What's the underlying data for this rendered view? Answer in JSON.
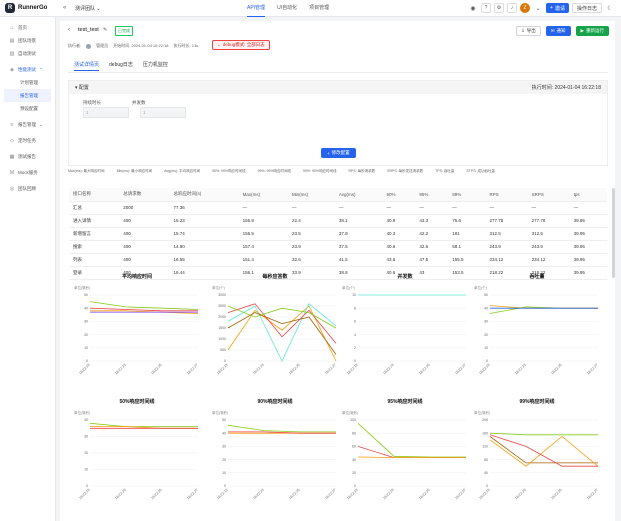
{
  "topbar": {
    "logo_text": "RunnerGo",
    "project": "测评团队",
    "nav": [
      "API管理",
      "UI自动化",
      "项目管理"
    ],
    "active_nav": 0,
    "invite_label": "邀请",
    "log_label": "操作日志",
    "avatar_letter": "Z"
  },
  "sidebar": {
    "items": [
      {
        "icon": "⌂",
        "label": "首页"
      },
      {
        "icon": "▤",
        "label": "团队场景"
      },
      {
        "icon": "▥",
        "label": "自动测试"
      },
      {
        "icon": "◈",
        "label": "性能测试"
      },
      {
        "icon": "≡",
        "label": "报告管理"
      },
      {
        "icon": "◇",
        "label": "定时任务"
      },
      {
        "icon": "▦",
        "label": "测试报告"
      },
      {
        "icon": "M",
        "label": "Mock服务"
      },
      {
        "icon": "◎",
        "label": "团队回顾"
      }
    ],
    "sub_items": [
      "计划管理",
      "报告管理",
      "预设配置"
    ],
    "active_sub": 1
  },
  "header": {
    "test_name": "test_test",
    "status_tag": "已完成",
    "executor_label": "执行者:",
    "executor": "管理员",
    "start_time": "开始时间: 2024-01-04 16:22:18",
    "duration": "执行时长: 13s",
    "debug_label": "debug模式: 全部日志",
    "actions": [
      "导出",
      "通知",
      "重新运行"
    ]
  },
  "tabs": [
    "测试详情页",
    "debug日志",
    "压力机监控"
  ],
  "active_tab": 0,
  "config": {
    "title": "配置",
    "exec_time": "执行时间: 2024-01-04 16:22:18",
    "labels": [
      "持续时长",
      "并发数"
    ],
    "inputs": [
      "1",
      "1"
    ],
    "add_label": "修改配置"
  },
  "legend": [
    "Max(ms): 最大响应时间",
    "Min(ms): 最小响应时间",
    "Avg(ms): 平均响应时间",
    "90%: 90%响应时间线",
    "95%: 95%响应时间线",
    "99%: 99%响应时间线",
    "RPS: 每秒请求数",
    "SRPS: 每秒发送请求数",
    "TPS: 吞吐量",
    "STPS: 成功吞吐量"
  ],
  "table": {
    "columns": [
      "接口名称",
      "总请求数",
      "总响应时间(s)",
      "Max(ms)",
      "Min(ms)",
      "Avg(ms)",
      "90%",
      "95%",
      "99%",
      "RPS",
      "SRPS",
      "tps"
    ],
    "rows": [
      [
        "汇总",
        "2000",
        "77.36",
        "—",
        "—",
        "—",
        "—",
        "—",
        "—",
        "—",
        "—",
        "—"
      ],
      [
        "进入详情",
        "400",
        "15.23",
        "156.9",
        "22.4",
        "38.1",
        "40.9",
        "43.3",
        "75.6",
        "277.78",
        "277.78",
        "39.95"
      ],
      [
        "新增留言",
        "400",
        "15.74",
        "156.5",
        "23.5",
        "37.9",
        "40.3",
        "42.2",
        "181",
        "312.5",
        "312.5",
        "39.95"
      ],
      [
        "搜索",
        "400",
        "14.90",
        "157.4",
        "23.9",
        "37.5",
        "40.6",
        "42.6",
        "58.1",
        "243.9",
        "243.9",
        "39.95"
      ],
      [
        "列表",
        "400",
        "16.55",
        "151.4",
        "32.6",
        "41.5",
        "43.6",
        "47.5",
        "155.5",
        "234.12",
        "234.12",
        "39.95"
      ],
      [
        "登录",
        "400",
        "16.44",
        "156.1",
        "33.9",
        "38.8",
        "40.6",
        "43",
        "153.5",
        "218.22",
        "218.22",
        "39.95"
      ]
    ]
  },
  "chart_data": [
    {
      "type": "line",
      "title": "平均响应时间",
      "ylabel": "单位(毫秒)",
      "ylim": [
        0,
        50
      ],
      "yticks": [
        0,
        10,
        20,
        30,
        40,
        50
      ],
      "x": [
        "16:22:19",
        "16:22:23",
        "16:22:25",
        "16:22:27"
      ],
      "series": [
        {
          "color": "#84cc16",
          "values": [
            45,
            41,
            40,
            39
          ]
        },
        {
          "color": "#f59e0b",
          "values": [
            38,
            38,
            37,
            36
          ]
        },
        {
          "color": "#ef4444",
          "values": [
            40,
            39,
            38,
            38
          ]
        },
        {
          "color": "#8b5cf6",
          "values": [
            37,
            37,
            37,
            37
          ]
        }
      ]
    },
    {
      "type": "line",
      "title": "每秒应答数",
      "ylabel": "单位(个)",
      "ylim": [
        0,
        3000
      ],
      "yticks": [
        0,
        500,
        1000,
        1500,
        2000,
        2500,
        3000
      ],
      "x": [
        "16:22:19",
        "16:22:23",
        "16:22:25",
        "16:22:27"
      ],
      "series": [
        {
          "color": "#f59e0b",
          "values": [
            500,
            2300,
            1400,
            2500,
            0
          ]
        },
        {
          "color": "#5eead4",
          "values": [
            1800,
            2500,
            0,
            2600,
            1600
          ]
        },
        {
          "color": "#ef4444",
          "values": [
            2200,
            2600,
            1100,
            2300,
            800
          ]
        },
        {
          "color": "#84cc16",
          "values": [
            2500,
            2000,
            2400,
            2200,
            1500
          ]
        },
        {
          "color": "#a16207",
          "values": [
            1500,
            2200,
            1700,
            2000,
            300
          ]
        }
      ]
    },
    {
      "type": "line",
      "title": "并发数",
      "ylabel": "单位(个)",
      "ylim": [
        0,
        10
      ],
      "yticks": [
        0,
        2,
        4,
        6,
        8,
        10
      ],
      "x": [
        "16:22:19",
        "16:22:23",
        "16:22:25",
        "16:22:27"
      ],
      "series": [
        {
          "color": "#5eead4",
          "values": [
            10,
            10,
            10,
            10
          ]
        }
      ]
    },
    {
      "type": "line",
      "title": "吞吐量",
      "ylabel": "单位(个)",
      "ylim": [
        0,
        50
      ],
      "yticks": [
        0,
        10,
        20,
        30,
        40,
        50
      ],
      "x": [
        "16:22:19",
        "16:22:23",
        "16:22:25",
        "16:22:27"
      ],
      "series": [
        {
          "color": "#84cc16",
          "values": [
            36,
            41,
            40,
            40
          ]
        },
        {
          "color": "#f59e0b",
          "values": [
            42,
            40,
            40,
            40
          ]
        },
        {
          "color": "#2563eb",
          "values": [
            40,
            40,
            40,
            40
          ]
        }
      ]
    },
    {
      "type": "line",
      "title": "50%响应时间线",
      "ylabel": "单位(毫秒)",
      "ylim": [
        0,
        40
      ],
      "yticks": [
        0,
        10,
        20,
        30,
        40
      ],
      "x": [
        "16:22:19",
        "16:22:23",
        "16:22:25",
        "16:22:27"
      ],
      "series": [
        {
          "color": "#84cc16",
          "values": [
            38,
            36,
            36,
            36
          ]
        },
        {
          "color": "#f59e0b",
          "values": [
            36,
            36,
            35,
            35
          ]
        },
        {
          "color": "#ef4444",
          "values": [
            35,
            35,
            35,
            35
          ]
        }
      ]
    },
    {
      "type": "line",
      "title": "90%响应时间线",
      "ylabel": "单位(毫秒)",
      "ylim": [
        0,
        50
      ],
      "yticks": [
        0,
        10,
        20,
        30,
        40,
        50
      ],
      "x": [
        "16:22:19",
        "16:22:23",
        "16:22:25",
        "16:22:27"
      ],
      "series": [
        {
          "color": "#84cc16",
          "values": [
            46,
            42,
            41,
            41
          ]
        },
        {
          "color": "#f59e0b",
          "values": [
            40,
            40,
            40,
            40
          ]
        },
        {
          "color": "#ef4444",
          "values": [
            41,
            41,
            40,
            40
          ]
        }
      ]
    },
    {
      "type": "line",
      "title": "95%响应时间线",
      "ylabel": "单位(毫秒)",
      "ylim": [
        0,
        100
      ],
      "yticks": [
        0,
        20,
        40,
        60,
        80,
        100
      ],
      "x": [
        "16:22:19",
        "16:22:23",
        "16:22:25",
        "16:22:27"
      ],
      "series": [
        {
          "color": "#84cc16",
          "values": [
            95,
            45,
            44,
            44
          ]
        },
        {
          "color": "#ef4444",
          "values": [
            60,
            43,
            43,
            43
          ]
        },
        {
          "color": "#f59e0b",
          "values": [
            44,
            43,
            43,
            43
          ]
        }
      ]
    },
    {
      "type": "line",
      "title": "99%响应时间线",
      "ylabel": "单位(毫秒)",
      "ylim": [
        0,
        200
      ],
      "yticks": [
        0,
        40,
        80,
        120,
        160,
        200
      ],
      "x": [
        "16:22:19",
        "16:22:23",
        "16:22:25",
        "16:22:27"
      ],
      "series": [
        {
          "color": "#84cc16",
          "values": [
            160,
            155,
            155,
            155
          ]
        },
        {
          "color": "#a16207",
          "values": [
            150,
            70,
            70,
            70
          ]
        },
        {
          "color": "#f59e0b",
          "values": [
            140,
            60,
            150,
            60
          ]
        },
        {
          "color": "#ef4444",
          "values": [
            155,
            120,
            60,
            60
          ]
        }
      ]
    }
  ]
}
